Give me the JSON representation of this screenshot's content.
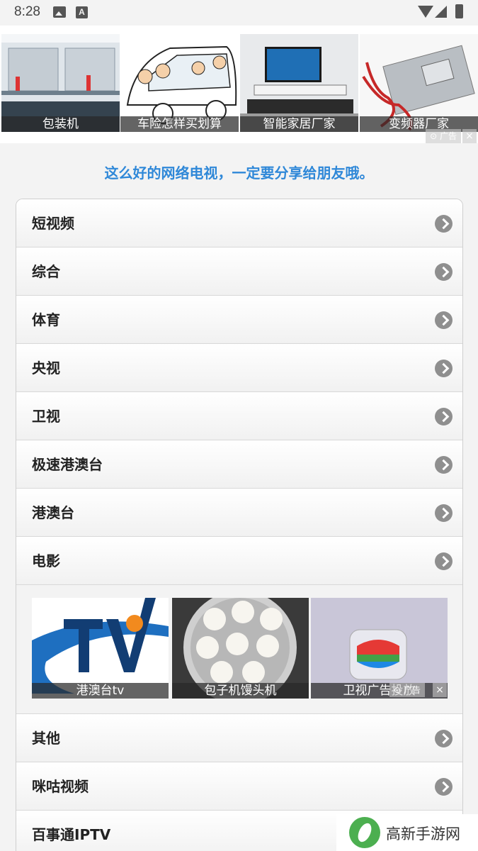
{
  "status_bar": {
    "time": "8:28"
  },
  "top_ad": {
    "tiles": [
      {
        "caption": "包装机"
      },
      {
        "caption": "车险怎样买划算"
      },
      {
        "caption": "智能家居厂家"
      },
      {
        "caption": "变频器厂家"
      }
    ],
    "ad_label": "广告",
    "close": "×"
  },
  "slogan": "这么好的网络电视，一定要分享给朋友哦。",
  "menu": {
    "items": [
      {
        "label": "短视频"
      },
      {
        "label": "综合"
      },
      {
        "label": "体育"
      },
      {
        "label": "央视"
      },
      {
        "label": "卫视"
      },
      {
        "label": "极速港澳台"
      },
      {
        "label": "港澳台"
      },
      {
        "label": "电影"
      },
      {
        "label": "其他"
      },
      {
        "label": "咪咕视频"
      },
      {
        "label": "百事通IPTV"
      }
    ]
  },
  "inner_ad": {
    "tiles": [
      {
        "caption": "港澳台tv"
      },
      {
        "caption": "包子机馒头机"
      },
      {
        "caption": "卫视广告投放"
      }
    ],
    "ad_label": "广告",
    "close": "×"
  },
  "watermark": {
    "text": "高新手游网"
  },
  "colors": {
    "slogan": "#2f88d8",
    "chevron": "#8f8f8f"
  }
}
